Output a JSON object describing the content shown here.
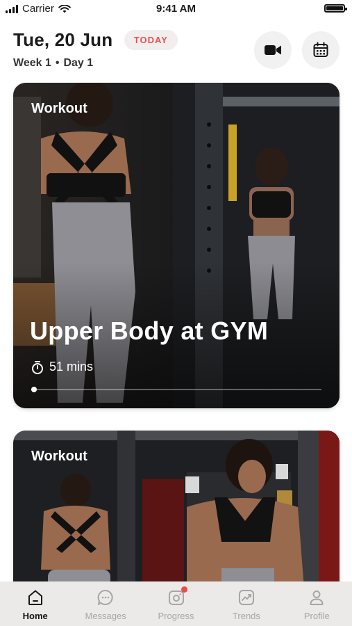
{
  "status_bar": {
    "carrier": "Carrier",
    "time": "9:41 AM"
  },
  "header": {
    "date": "Tue, 20 Jun",
    "today_badge": "TODAY",
    "week": "Week 1",
    "separator": "•",
    "day": "Day 1",
    "video_icon": "video-camera-icon",
    "calendar_icon": "calendar-icon"
  },
  "cards": [
    {
      "label": "Workout",
      "title": "Upper Body at GYM",
      "duration": "51 mins",
      "duration_icon": "stopwatch-icon",
      "progress_fraction": 0.01
    },
    {
      "label": "Workout"
    }
  ],
  "tabbar": {
    "items": [
      {
        "label": "Home",
        "icon": "home-icon",
        "active": true
      },
      {
        "label": "Messages",
        "icon": "chat-bubble-icon",
        "active": false
      },
      {
        "label": "Progress",
        "icon": "camera-icon",
        "active": false,
        "has_notification": true
      },
      {
        "label": "Trends",
        "icon": "trend-chart-icon",
        "active": false
      },
      {
        "label": "Profile",
        "icon": "person-icon",
        "active": false
      }
    ]
  },
  "colors": {
    "accent": "#e4534f",
    "badge_bg": "#f3eeee",
    "tabbar_bg": "#ece9e9",
    "tab_inactive": "#a7a5a5",
    "notification": "#f04a43"
  }
}
